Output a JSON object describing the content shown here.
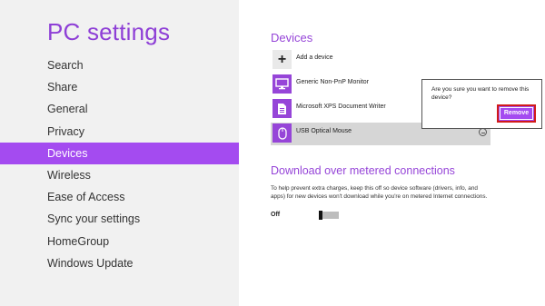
{
  "app": {
    "title": "PC settings"
  },
  "nav": {
    "items": [
      {
        "label": "Search"
      },
      {
        "label": "Share"
      },
      {
        "label": "General"
      },
      {
        "label": "Privacy"
      },
      {
        "label": "Devices",
        "selected": true
      },
      {
        "label": "Wireless"
      },
      {
        "label": "Ease of Access"
      },
      {
        "label": "Sync your settings"
      },
      {
        "label": "HomeGroup"
      },
      {
        "label": "Windows Update"
      }
    ]
  },
  "devices": {
    "title": "Devices",
    "add_label": "Add a device",
    "add_icon": "+",
    "list": [
      {
        "label": "Generic Non-PnP Monitor",
        "icon": "monitor-icon"
      },
      {
        "label": "Microsoft XPS Document Writer",
        "icon": "document-icon"
      },
      {
        "label": "USB Optical Mouse",
        "icon": "mouse-icon",
        "selected": true
      }
    ]
  },
  "flyout": {
    "message": "Are you sure you want to remove this device?",
    "remove_label": "Remove"
  },
  "metered": {
    "title": "Download over metered connections",
    "description": "To help prevent extra charges, keep this off so device software (drivers, info, and apps) for new devices won't download while you're on metered Internet connections.",
    "state_label": "Off",
    "enabled": false
  },
  "colors": {
    "accent": "#a44bf0",
    "title_text": "#8e3fd6",
    "left_panel_bg": "#f1f1f1",
    "highlight_border": "#d11a1a"
  }
}
